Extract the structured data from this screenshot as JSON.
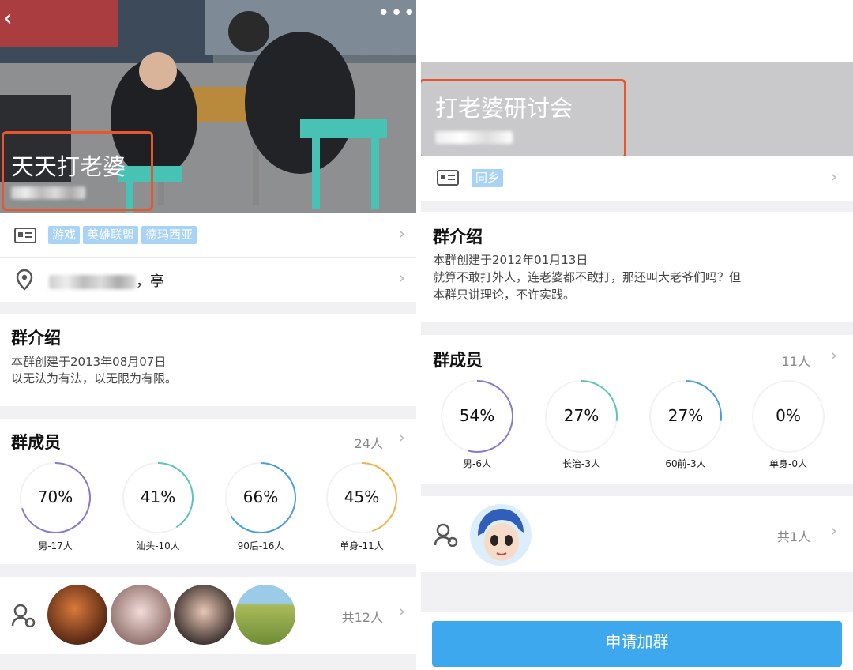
{
  "left": {
    "group_name": "天天打老婆",
    "tags": [
      "游戏",
      "英雄联盟",
      "德玛西亚"
    ],
    "location_tail": "，亭",
    "intro_title": "群介绍",
    "intro_lines": [
      "本群创建于2013年08月07日",
      "以无法为有法，以无限为有限。"
    ],
    "members_title": "群成员",
    "members_count": "24人",
    "stats": [
      {
        "percent": "70%",
        "label": "男-17人",
        "fraction": 0.7,
        "color": "#8a76cc"
      },
      {
        "percent": "41%",
        "label": "汕头-10人",
        "fraction": 0.41,
        "color": "#5fc4b8"
      },
      {
        "percent": "66%",
        "label": "90后-16人",
        "fraction": 0.66,
        "color": "#4a9de0"
      },
      {
        "percent": "45%",
        "label": "单身-11人",
        "fraction": 0.45,
        "color": "#f0b34a"
      }
    ],
    "total_members": "共12人"
  },
  "right": {
    "group_name": "打老婆研讨会",
    "tag": "同乡",
    "intro_title": "群介绍",
    "intro_lines": [
      "本群创建于2012年01月13日",
      "就算不敢打外人，连老婆都不敢打，那还叫大老爷们吗？但",
      "本群只讲理论，不许实践。"
    ],
    "members_title": "群成员",
    "members_count": "11人",
    "stats": [
      {
        "percent": "54%",
        "label": "男-6人",
        "fraction": 0.54,
        "color": "#8a76cc"
      },
      {
        "percent": "27%",
        "label": "长治-3人",
        "fraction": 0.27,
        "color": "#5fc4b8"
      },
      {
        "percent": "27%",
        "label": "60前-3人",
        "fraction": 0.27,
        "color": "#4a9de0"
      },
      {
        "percent": "0%",
        "label": "单身-0人",
        "fraction": 0.0,
        "color": "#f0b34a"
      }
    ],
    "total_members": "共1人",
    "join_button": "申请加群"
  },
  "colors": {
    "accent": "#3da8ee",
    "highlight_box": "#e8562a",
    "tag_bg": "#a9d3f5"
  }
}
